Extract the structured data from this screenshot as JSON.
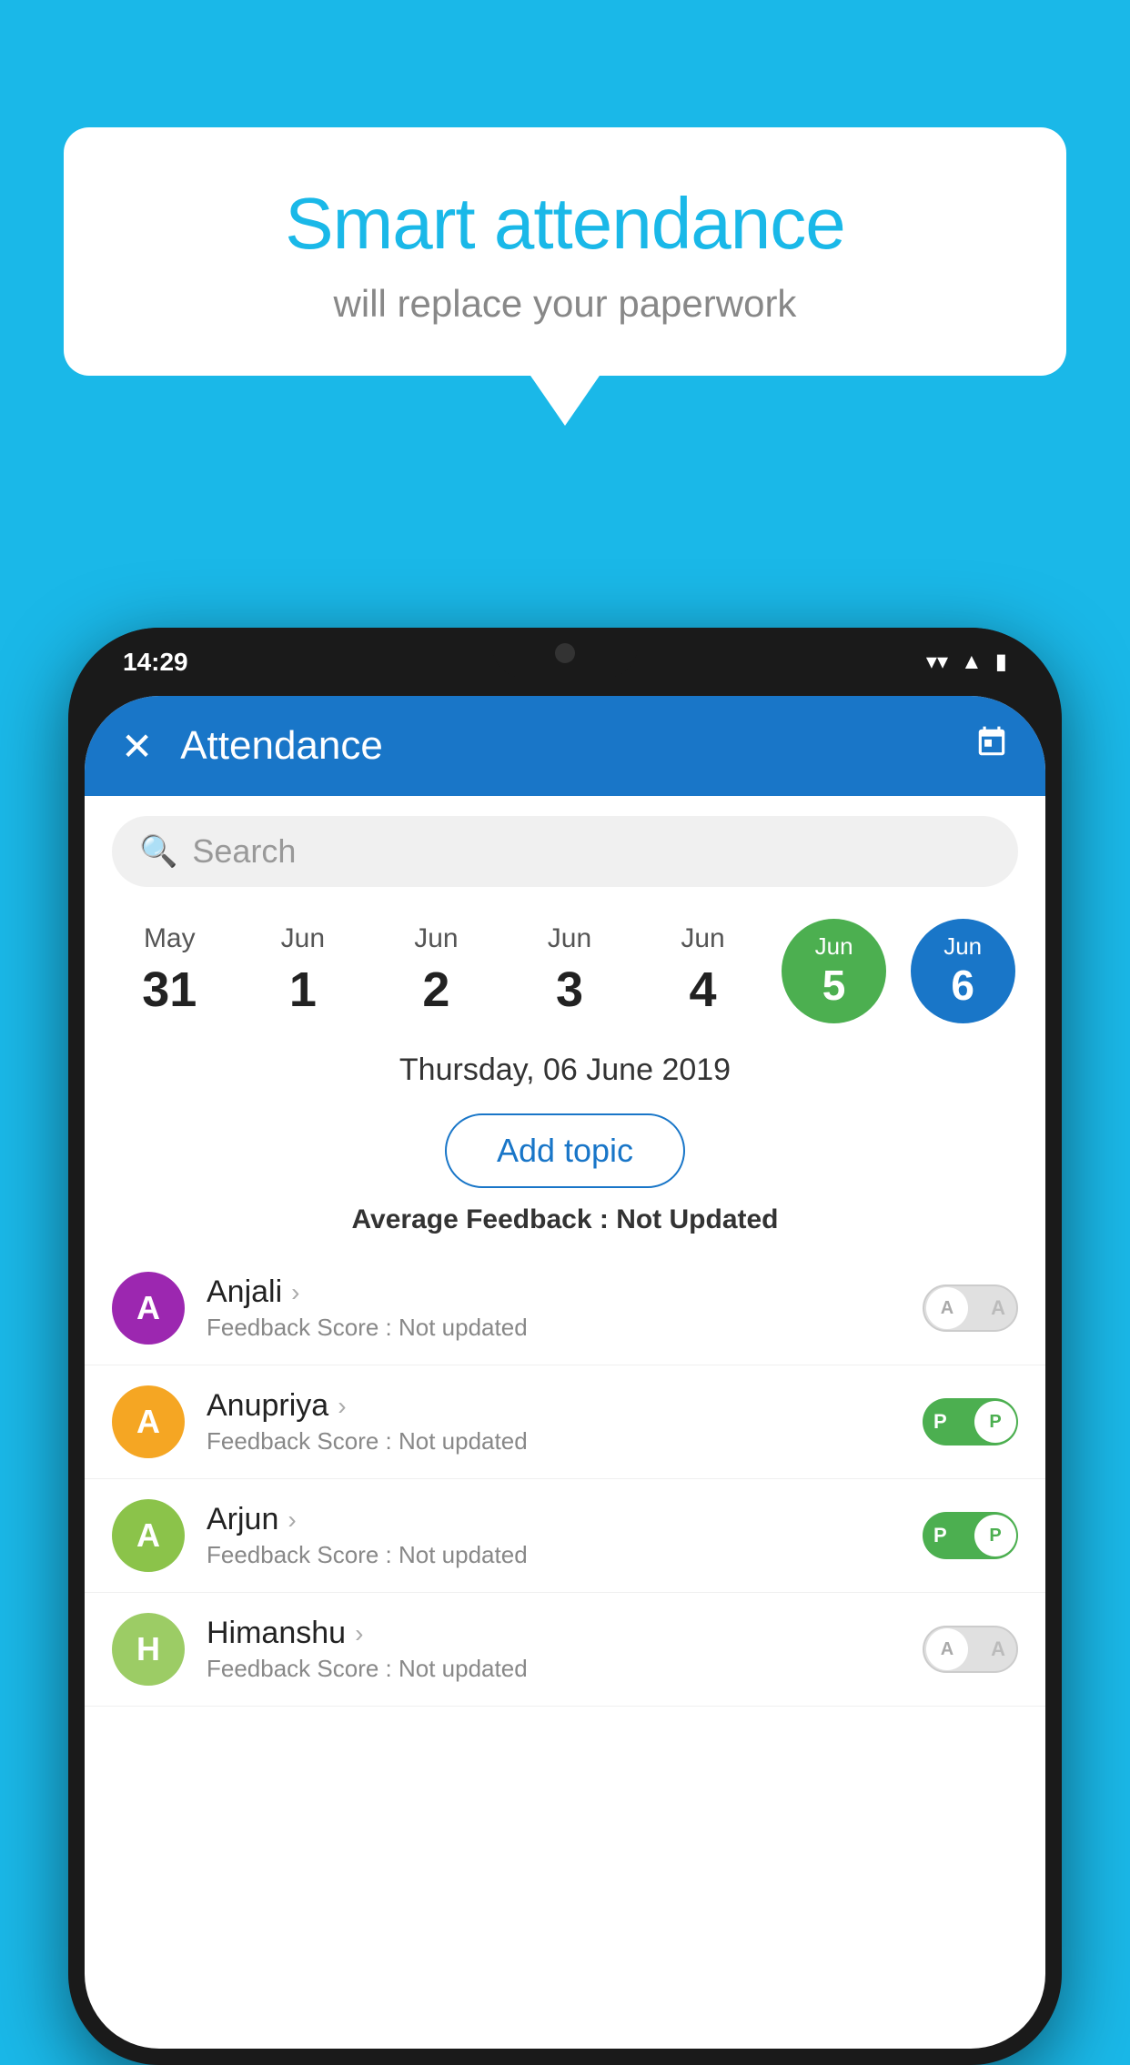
{
  "background_color": "#1ab8e8",
  "speech_bubble": {
    "title": "Smart attendance",
    "subtitle": "will replace your paperwork"
  },
  "status_bar": {
    "time": "14:29",
    "wifi": "wifi-icon",
    "signal": "signal-icon",
    "battery": "battery-icon"
  },
  "app_header": {
    "title": "Attendance",
    "close_label": "✕",
    "calendar_label": "📅"
  },
  "search": {
    "placeholder": "Search"
  },
  "dates": [
    {
      "month": "May",
      "day": "31",
      "style": "normal"
    },
    {
      "month": "Jun",
      "day": "1",
      "style": "normal"
    },
    {
      "month": "Jun",
      "day": "2",
      "style": "normal"
    },
    {
      "month": "Jun",
      "day": "3",
      "style": "normal"
    },
    {
      "month": "Jun",
      "day": "4",
      "style": "normal"
    },
    {
      "month": "Jun",
      "day": "5",
      "style": "today-green"
    },
    {
      "month": "Jun",
      "day": "6",
      "style": "selected-blue"
    }
  ],
  "selected_date": "Thursday, 06 June 2019",
  "add_topic_label": "Add topic",
  "avg_feedback": {
    "label": "Average Feedback :",
    "value": "Not Updated"
  },
  "students": [
    {
      "name": "Anjali",
      "avatar_letter": "A",
      "avatar_color": "#9c27b0",
      "score_label": "Feedback Score :",
      "score_value": "Not updated",
      "toggle_state": "off",
      "toggle_letter": "A"
    },
    {
      "name": "Anupriya",
      "avatar_letter": "A",
      "avatar_color": "#f5a623",
      "score_label": "Feedback Score :",
      "score_value": "Not updated",
      "toggle_state": "on",
      "toggle_letter": "P"
    },
    {
      "name": "Arjun",
      "avatar_letter": "A",
      "avatar_color": "#8bc34a",
      "score_label": "Feedback Score :",
      "score_value": "Not updated",
      "toggle_state": "on",
      "toggle_letter": "P"
    },
    {
      "name": "Himanshu",
      "avatar_letter": "H",
      "avatar_color": "#9ccc65",
      "score_label": "Feedback Score :",
      "score_value": "Not updated",
      "toggle_state": "off",
      "toggle_letter": "A"
    }
  ]
}
